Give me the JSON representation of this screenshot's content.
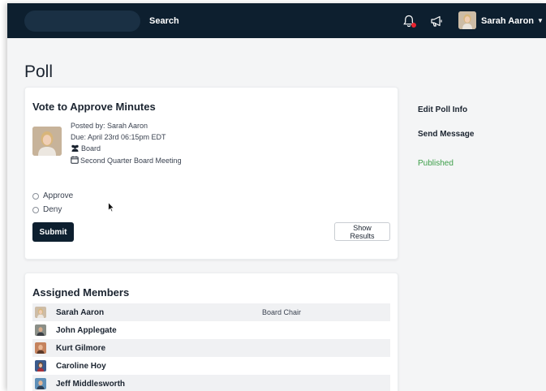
{
  "nav": {
    "search_value": "",
    "search_label": "Search",
    "user_name": "Sarah Aaron",
    "notification_dot_color": "#e8232f",
    "icons": [
      "bell-icon",
      "megaphone-icon",
      "chevron-down-icon"
    ]
  },
  "page": {
    "title": "Poll"
  },
  "poll": {
    "title": "Vote to Approve Minutes",
    "posted_by": "Posted by: Sarah Aaron",
    "due": "Due: April 23rd 06:15pm EDT",
    "group": "Board",
    "meeting": "Second Quarter Board Meeting",
    "options": [
      "Approve",
      "Deny"
    ],
    "submit_label": "Submit",
    "show_results_label": "Show Results"
  },
  "sidebar": {
    "edit_label": "Edit Poll Info",
    "message_label": "Send Message",
    "status": "Published",
    "status_color": "#3c9e48"
  },
  "members": {
    "title": "Assigned Members",
    "rows": [
      {
        "name": "Sarah Aaron",
        "role": "Board Chair"
      },
      {
        "name": "John Applegate",
        "role": ""
      },
      {
        "name": "Kurt Gilmore",
        "role": ""
      },
      {
        "name": "Caroline Hoy",
        "role": ""
      },
      {
        "name": "Jeff Middlesworth",
        "role": ""
      }
    ]
  }
}
